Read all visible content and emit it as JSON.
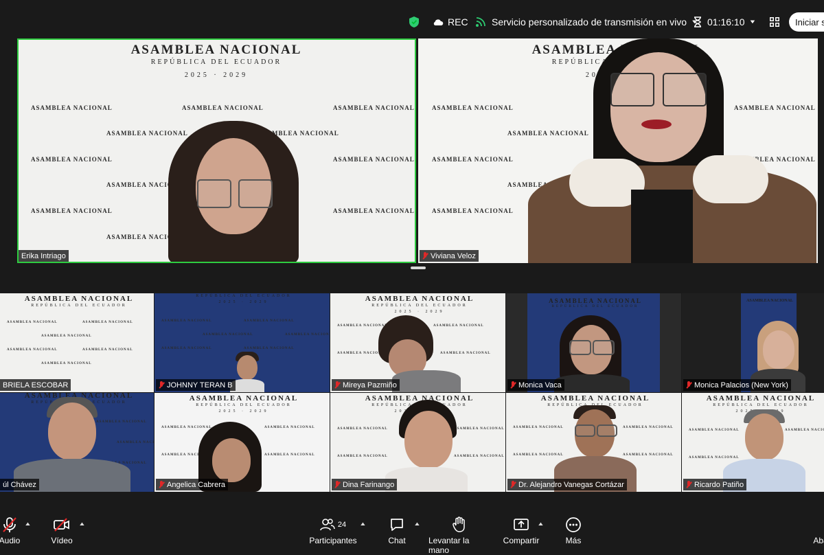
{
  "topbar": {
    "rec_label": "REC",
    "stream_label": "Servicio personalizado de transmisión en vivo",
    "timer": "01:16:10",
    "start_button": "Iniciar s"
  },
  "backdrop": {
    "line1": "ASAMBLEA NACIONAL",
    "line2": "REPÚBLICA DEL ECUADOR",
    "years": "2025 · 2029"
  },
  "participants": [
    {
      "name": "Erika Intriago",
      "muted": false
    },
    {
      "name": "Viviana Veloz",
      "muted": true
    },
    {
      "name": "BRIELA ESCOBAR",
      "muted": false
    },
    {
      "name": "JOHNNY TERAN B",
      "muted": true
    },
    {
      "name": "Mireya Pazmiño",
      "muted": true
    },
    {
      "name": "Monica Vaca",
      "muted": true
    },
    {
      "name": "Monica Palacios (New York)",
      "muted": true
    },
    {
      "name": "úl Chávez",
      "muted": false
    },
    {
      "name": "Angelica Cabrera",
      "muted": true
    },
    {
      "name": "Dina Farinango",
      "muted": true
    },
    {
      "name": "Dr. Alejandro Vanegas Cortázar",
      "muted": true
    },
    {
      "name": "Ricardo Patiño",
      "muted": true
    }
  ],
  "toolbar": {
    "audio": "Audio",
    "video": "Vídeo",
    "participants": "Participantes",
    "participants_count": "24",
    "chat": "Chat",
    "raise_hand": "Levantar la mano",
    "share": "Compartir",
    "more": "Más",
    "leave": "Aba"
  },
  "colors": {
    "active_speaker": "#2ecc40",
    "muted": "#e02828",
    "shield": "#2ecc71",
    "background": "#1a1a1a"
  }
}
